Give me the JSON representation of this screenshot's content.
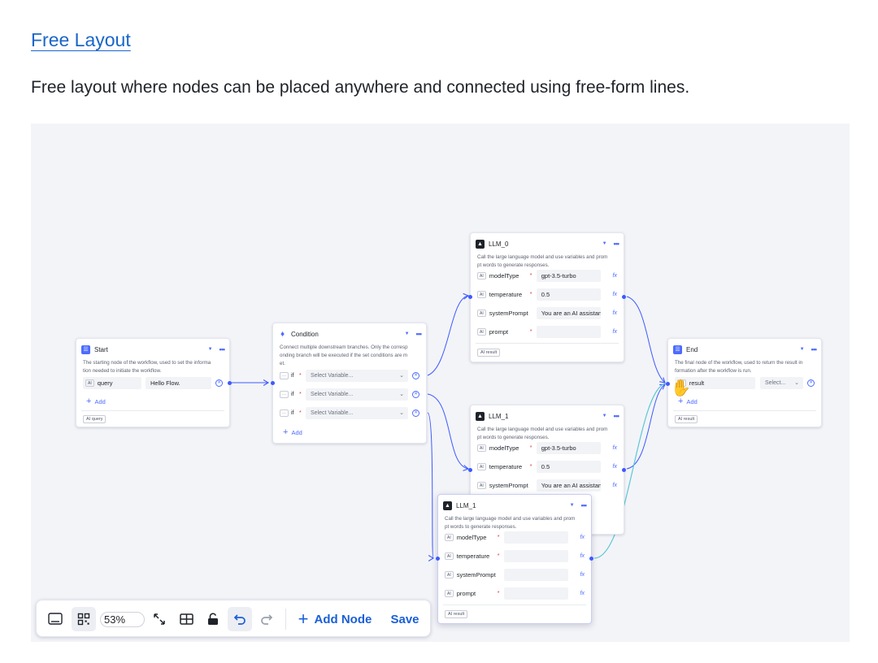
{
  "page": {
    "title_link": "Free Layout",
    "description": "Free layout where nodes can be placed anywhere and connected using free-form lines."
  },
  "nodes": {
    "start": {
      "title": "Start",
      "desc_1": "The starting node of the workflow, used to set the informa",
      "desc_2": "tion needed to initiate the workflow.",
      "field_tag": "AI",
      "field_name": "query",
      "field_value": "Hello Flow.",
      "add": "Add",
      "output_tag": "AI query"
    },
    "condition": {
      "title": "Condition",
      "desc_1": "Connect multiple downstream branches. Only the corresp",
      "desc_2": "onding branch will be executed if the set conditions are m",
      "desc_3": "et.",
      "if_tag": "⋯",
      "if_label": "if",
      "placeholder": "Select Variable...",
      "add": "Add"
    },
    "llm0": {
      "title": "LLM_0",
      "desc_1": "Call the large language model and use variables and prom",
      "desc_2": "pt words to generate responses.",
      "f1_name": "modelType",
      "f1_value": "gpt-3.5-turbo",
      "f2_name": "temperature",
      "f2_value": "0.5",
      "f3_name": "systemPrompt",
      "f3_value": "You are an AI assistant.",
      "f4_name": "prompt",
      "f4_value": "",
      "output_tag": "AI result"
    },
    "llm1a": {
      "title": "LLM_1",
      "desc_1": "Call the large language model and use variables and prom",
      "desc_2": "pt words to generate responses.",
      "f1_name": "modelType",
      "f1_value": "gpt-3.5-turbo",
      "f2_name": "temperature",
      "f2_value": "0.5",
      "f3_name": "systemPrompt",
      "f3_value": "You are an AI assistant."
    },
    "llm1b": {
      "title": "LLM_1",
      "desc_1": "Call the large language model and use variables and prom",
      "desc_2": "pt words to generate responses.",
      "f1_name": "modelType",
      "f2_name": "temperature",
      "f3_name": "systemPrompt",
      "f4_name": "prompt",
      "output_tag": "AI result"
    },
    "end": {
      "title": "End",
      "desc_1": "The final node of the workflow, used to return the result in",
      "desc_2": "formation after the workflow is run.",
      "field_name": "result",
      "field_select": "Select...",
      "add": "Add",
      "output_tag": "AI result"
    }
  },
  "field_tag": "AI",
  "fx_icon": "fx",
  "toolbar": {
    "zoom": "53%",
    "add_node": "Add Node",
    "save": "Save"
  },
  "colors": {
    "accent": "#4d6bfe",
    "edge": "#3d5afe",
    "edge_highlight": "#5bc8d6",
    "link": "#1a66c9"
  }
}
